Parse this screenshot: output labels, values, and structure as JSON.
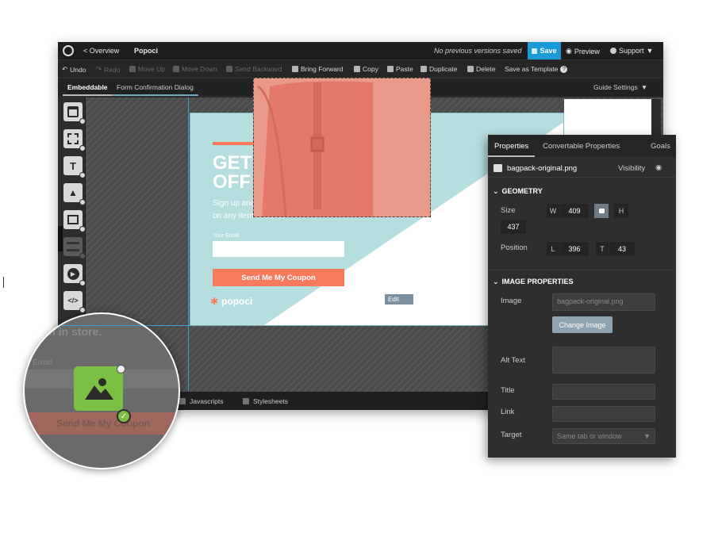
{
  "topbar": {
    "back_label": "< Overview",
    "project_name": "Popoci",
    "versions_text": "No previous versions saved",
    "save_label": "Save",
    "preview_label": "Preview",
    "support_label": "Support"
  },
  "toolbar": {
    "undo": "Undo",
    "redo": "Redo",
    "move_up": "Move Up",
    "move_down": "Move Down",
    "send_backward": "Send Backward",
    "bring_forward": "Bring Forward",
    "copy": "Copy",
    "paste": "Paste",
    "duplicate": "Duplicate",
    "delete": "Delete",
    "save_template": "Save as Template"
  },
  "tabs": {
    "embeddable": "Embeddable",
    "form_confirmation": "Form Confirmation Dialog",
    "guide_settings": "Guide Settings"
  },
  "sidebar": {
    "tools": [
      "box-icon",
      "frame-icon",
      "text-icon",
      "image-icon",
      "resize-icon",
      "form-icon",
      "video-icon",
      "code-icon"
    ]
  },
  "popup": {
    "headline_1": "GET 15%",
    "headline_2": "OFF TODAY",
    "subtext_1": "Sign up and redeem your 15% off",
    "subtext_2": "on any item in store.",
    "email_label": "Your Email",
    "cta_label": "Send Me My Coupon",
    "brand": "popoci",
    "edit_label": "Edit"
  },
  "bottombar": {
    "javascripts": "Javascripts",
    "stylesheets": "Stylesheets"
  },
  "properties": {
    "tab_properties": "Properties",
    "tab_convertable": "Convertable Properties",
    "tab_goals": "Goals",
    "file_name": "bagpack-original.png",
    "visibility_label": "Visibility",
    "geometry_title": "GEOMETRY",
    "size_label": "Size",
    "w_label": "W",
    "w_value": "409",
    "h_label": "H",
    "h_value": "437",
    "position_label": "Position",
    "l_label": "L",
    "l_value": "396",
    "t_label": "T",
    "t_value": "43",
    "image_props_title": "IMAGE PROPERTIES",
    "image_label": "Image",
    "image_value": "bagpack-original.png",
    "change_image": "Change Image",
    "alt_text_label": "Alt Text",
    "title_label": "Title",
    "link_label": "Link",
    "target_label": "Target",
    "target_value": "Same tab or window"
  },
  "magnifier": {
    "bg_text_1": "item in store.",
    "bg_text_2": "Email",
    "bg_cta": "Send Me My Coupon"
  },
  "colors": {
    "accent_blue": "#1a9ad6",
    "coral": "#f77a5d",
    "teal": "#b7dede",
    "green": "#7cc043"
  }
}
